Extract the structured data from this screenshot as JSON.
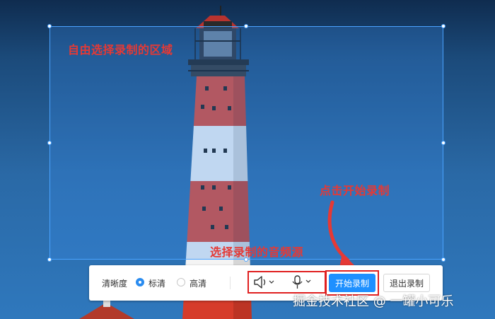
{
  "annotations": {
    "select_region": "自由选择录制的区域",
    "click_start": "点击开始录制",
    "select_audio": "选择录制的音频源"
  },
  "toolbar": {
    "quality_label": "清晰度",
    "quality_options": [
      {
        "label": "标清",
        "selected": true
      },
      {
        "label": "高清",
        "selected": false
      }
    ],
    "speaker_icon": "speaker-icon",
    "mic_icon": "microphone-icon",
    "start_label": "开始录制",
    "exit_label": "退出录制"
  },
  "watermark": "掘金技术社区 @ 一罐小可乐",
  "colors": {
    "annotation": "#e53935",
    "primary_button": "#1e90ff",
    "selection_border": "#4aa3ff"
  }
}
